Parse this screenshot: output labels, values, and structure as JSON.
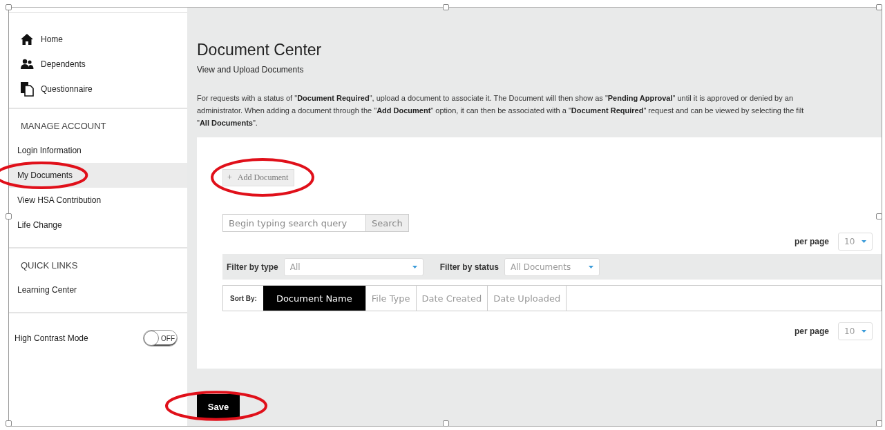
{
  "sidebar": {
    "nav": [
      {
        "label": "Home"
      },
      {
        "label": "Dependents"
      },
      {
        "label": "Questionnaire"
      }
    ],
    "sections": [
      {
        "heading": "MANAGE ACCOUNT",
        "items": [
          {
            "label": "Login Information",
            "selected": false
          },
          {
            "label": "My Documents",
            "selected": true
          },
          {
            "label": "View HSA Contribution",
            "selected": false
          },
          {
            "label": "Life Change",
            "selected": false
          }
        ]
      },
      {
        "heading": "QUICK LINKS",
        "items": [
          {
            "label": "Learning Center",
            "selected": false
          }
        ]
      }
    ],
    "high_contrast": {
      "label": "High Contrast Mode",
      "on": false,
      "state_text": "OFF"
    }
  },
  "page": {
    "title": "Document Center",
    "subtitle": "View and Upload Documents",
    "intro": "For requests with a status of \"**Document Required**\", upload a document to associate it. The Document will then show as \"**Pending Approval**\" until it is approved or denied by an\nadministrator. When adding a document through the \"**Add Document**\" option, it can then be associated with a \"**Document Required**\" request and can be viewed by selecting the filt\n\"**All Documents**\"."
  },
  "documents": {
    "add_button": {
      "icon_text": "+",
      "label": "Add Document"
    },
    "search": {
      "placeholder": "Begin typing search query",
      "button": "Search"
    },
    "per_page_top": {
      "label": "per page",
      "value": "10"
    },
    "filters": [
      {
        "label": "Filter by type",
        "value": "All"
      },
      {
        "label": "Filter by status",
        "value": "All Documents"
      }
    ],
    "sort": {
      "label": "Sort By:",
      "options": [
        {
          "label": "Document Name",
          "selected": true
        },
        {
          "label": "File Type",
          "selected": false
        },
        {
          "label": "Date Created",
          "selected": false
        },
        {
          "label": "Date Uploaded",
          "selected": false
        }
      ]
    },
    "per_page_bottom": {
      "label": "per page",
      "value": "10"
    }
  },
  "save_button": "Save"
}
